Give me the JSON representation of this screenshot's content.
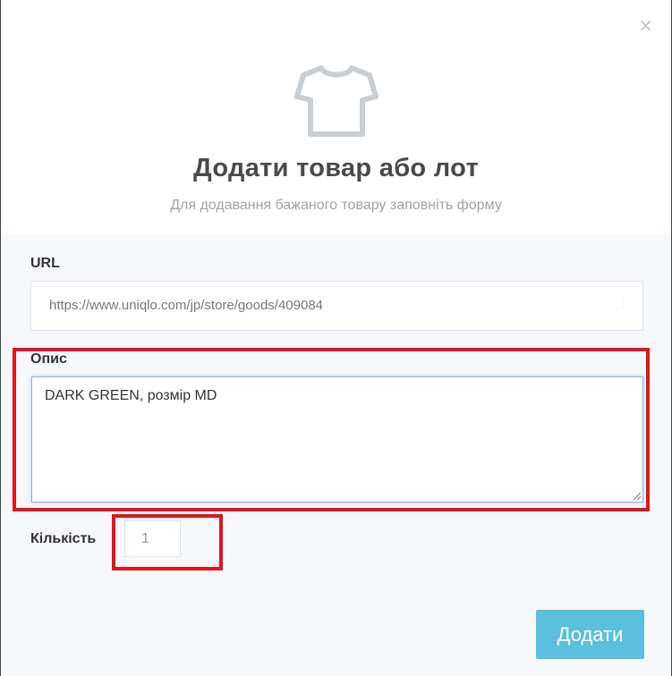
{
  "modal": {
    "close_icon": "×",
    "icon": "tshirt-icon",
    "title": "Додати товар або лот",
    "subtitle": "Для додавання бажаного товару заповніть форму"
  },
  "form": {
    "url_label": "URL",
    "url_value": "https://www.uniqlo.com/jp/store/goods/409084",
    "description_label": "Опис",
    "description_value": "DARK GREEN, розмір MD",
    "quantity_label": "Кількість",
    "quantity_value": "1",
    "submit_label": "Додати"
  },
  "colors": {
    "highlight": "#e2141d",
    "submit": "#5bc0de"
  }
}
